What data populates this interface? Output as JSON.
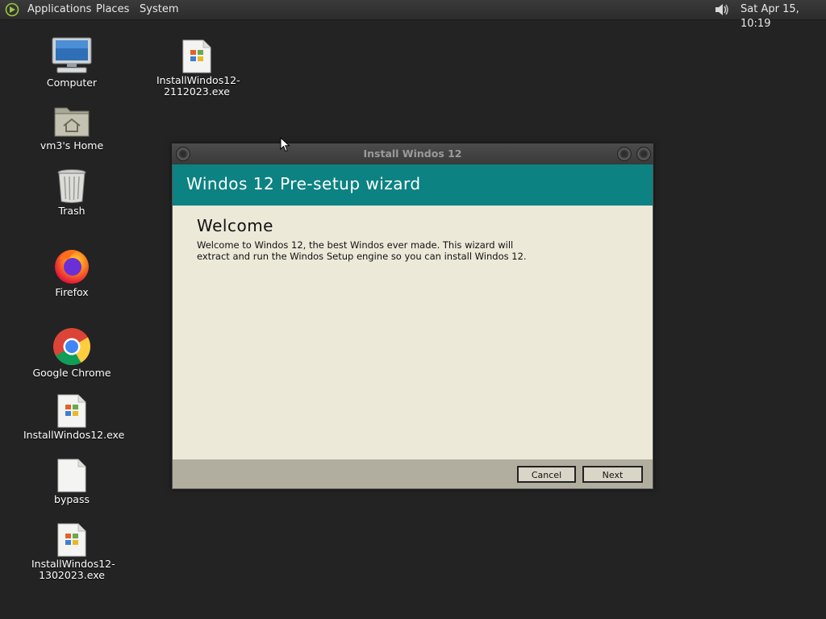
{
  "top_panel": {
    "menus": [
      "Applications",
      "Places",
      "System"
    ],
    "clock": "Sat Apr 15, 10:19"
  },
  "desktop": {
    "icons": [
      {
        "label": "Computer",
        "icon": "computer-icon"
      },
      {
        "label": "vm3's Home",
        "icon": "home-folder-icon"
      },
      {
        "label": "Trash",
        "icon": "trash-icon"
      },
      {
        "label": "Firefox",
        "icon": "firefox-icon"
      },
      {
        "label": "Google Chrome",
        "icon": "chrome-icon"
      },
      {
        "label": "InstallWindos12.exe",
        "icon": "exe-file-icon"
      },
      {
        "label": "bypass",
        "icon": "blank-file-icon"
      },
      {
        "label": "InstallWindos12-1302023.exe",
        "icon": "exe-file-icon"
      },
      {
        "label": "InstallWindos12-2112023.exe",
        "icon": "exe-file-icon"
      }
    ]
  },
  "window": {
    "title": "Install Windos 12",
    "header": "Windos 12 Pre-setup wizard",
    "heading": "Welcome",
    "body_text": "Welcome to Windos 12, the best Windos ever made. This wizard will extract and run the Windos Setup engine so you can install Windos 12.",
    "cancel_label": "Cancel",
    "next_label": "Next"
  },
  "colors": {
    "header_accent": "#0d8282",
    "body_bg": "#ece9d9",
    "desktop_bg": "#232323"
  }
}
